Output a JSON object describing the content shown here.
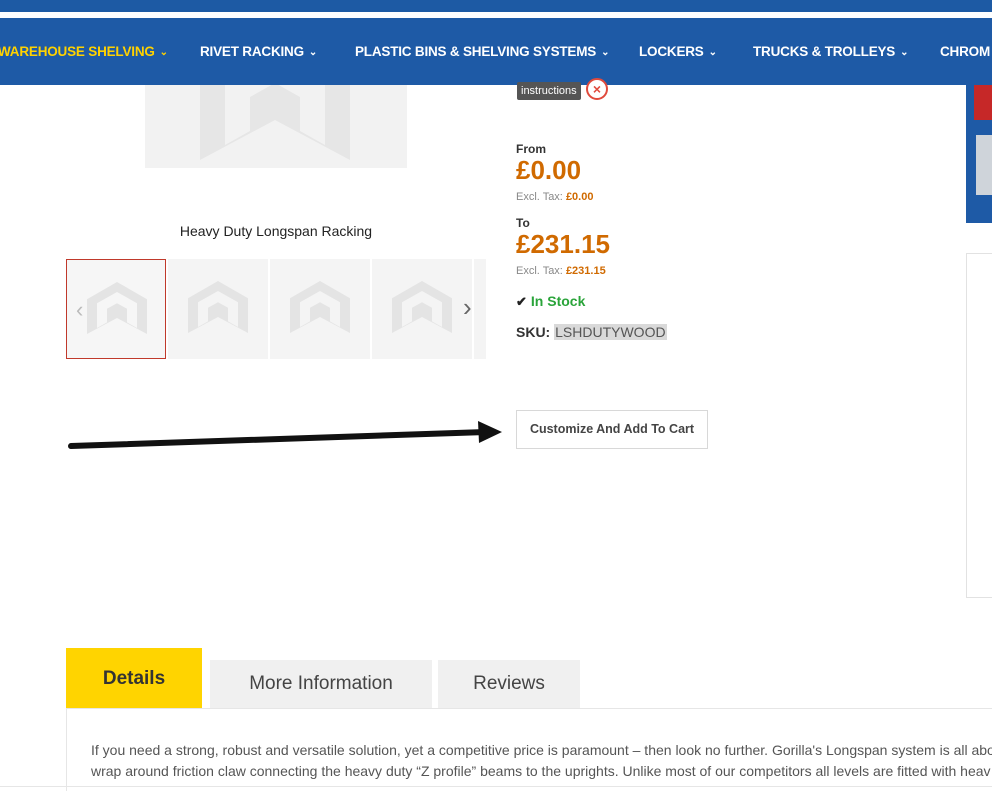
{
  "nav": {
    "items": [
      {
        "label": "WAREHOUSE SHELVING",
        "active": true
      },
      {
        "label": "RIVET RACKING"
      },
      {
        "label": "PLASTIC BINS & SHELVING SYSTEMS"
      },
      {
        "label": "LOCKERS"
      },
      {
        "label": "TRUCKS & TROLLEYS"
      },
      {
        "label": "CHROM"
      }
    ],
    "chevron": "⌄",
    "colors": {
      "background": "#1e5aa6",
      "active": "#ffd200",
      "text": "#ffffff"
    }
  },
  "gallery": {
    "caption": "Heavy Duty Longspan Racking",
    "thumbnails": [
      {
        "icon": "placeholder-logo-icon",
        "selected": true
      },
      {
        "icon": "placeholder-logo-icon"
      },
      {
        "icon": "placeholder-logo-icon"
      },
      {
        "icon": "placeholder-logo-icon"
      }
    ]
  },
  "product": {
    "instructions_label": "instructions",
    "from_label": "From",
    "from_price": "£0.00",
    "from_excl_label": "Excl. Tax:",
    "from_excl_price": "£0.00",
    "to_label": "To",
    "to_price": "£231.15",
    "to_excl_label": "Excl. Tax:",
    "to_excl_price": "£231.15",
    "stock": "In Stock",
    "sku_label": "SKU:",
    "sku_value": "LSHDUTYWOOD",
    "cart_button": "Customize And Add To Cart",
    "price_color": "#d06a00",
    "stock_color": "#2aa43a"
  },
  "tabs": [
    {
      "label": "Details",
      "active": true
    },
    {
      "label": "More Information"
    },
    {
      "label": "Reviews"
    }
  ],
  "description": {
    "line1": "If you need a strong, robust and versatile solution, yet a competitive price is paramount – then look no further. Gorilla's Longspan system is all abo",
    "line2": "wrap around friction claw connecting the heavy duty “Z profile” beams to the uprights. Unlike most of our competitors all levels are fitted with heav"
  },
  "colors": {
    "tab_active": "#ffd400",
    "tab_inactive": "#f0f0f0"
  }
}
